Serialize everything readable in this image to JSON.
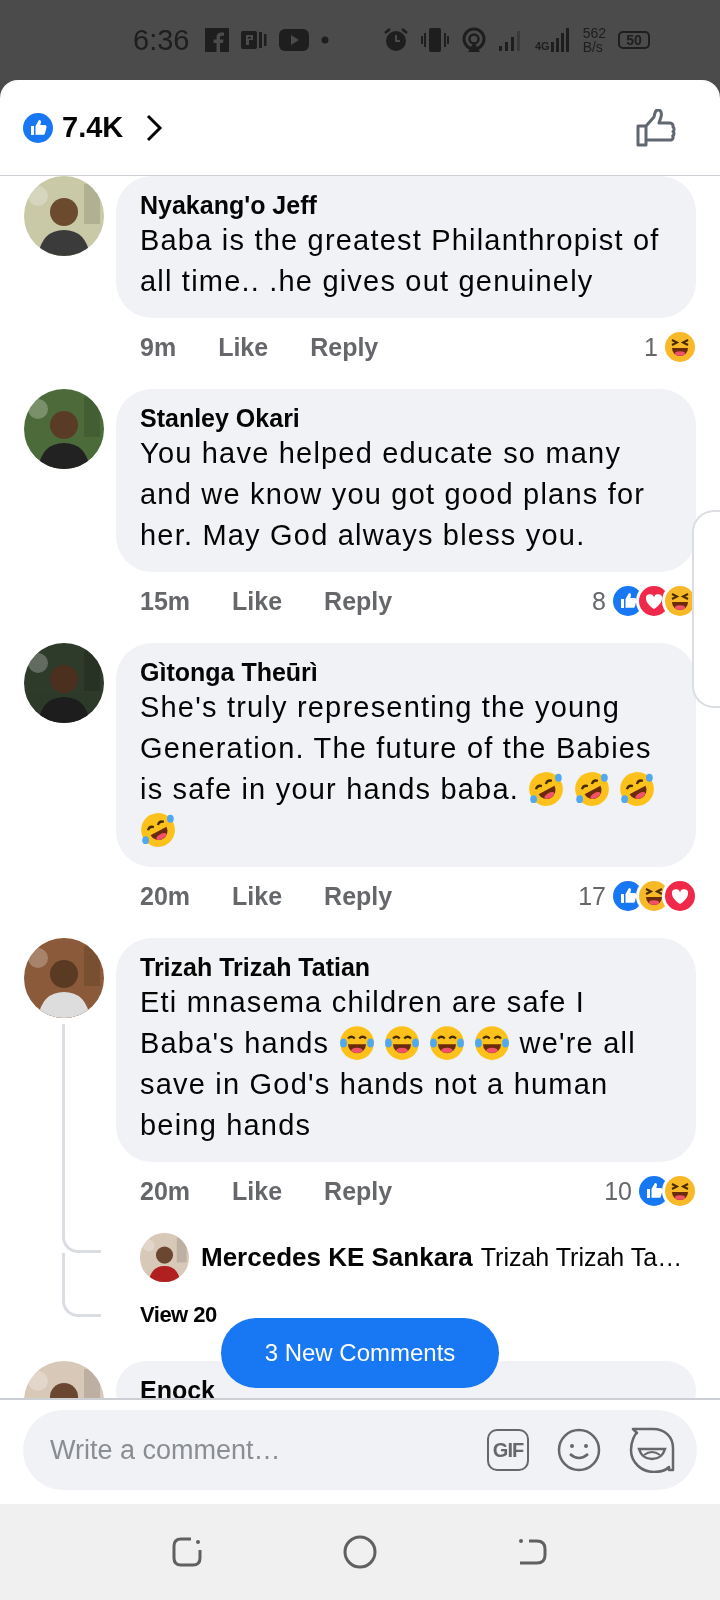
{
  "status_bar": {
    "time": "6:36",
    "network": "4G",
    "speed": "562",
    "speed_unit": "B/s",
    "battery": "50"
  },
  "header": {
    "reaction_count": "7.4K"
  },
  "comments": [
    {
      "author": "Nyakang'o Jeff",
      "body": [
        {
          "kind": "text",
          "text": "Baba is the greatest Philanthropist of all time.. .he gives out genuinely"
        }
      ],
      "time": "9m",
      "like": "Like",
      "reply": "Reply",
      "reaction_count": "1",
      "reactions": [
        {
          "kind": "haha"
        }
      ]
    },
    {
      "author": "Stanley Okari",
      "body": [
        {
          "kind": "text",
          "text": "You have helped educate so many and we know you got good plans for her. May God always bless you."
        }
      ],
      "time": "15m",
      "like": "Like",
      "reply": "Reply",
      "reaction_count": "8",
      "reactions": [
        {
          "kind": "like"
        },
        {
          "kind": "love"
        },
        {
          "kind": "haha"
        }
      ]
    },
    {
      "author": "Gìtonga Theūrì",
      "body": [
        {
          "kind": "text",
          "text": "She's truly representing the young Generation. The future of the Babies is safe in your hands baba."
        },
        {
          "kind": "rofl"
        },
        {
          "kind": "rofl"
        },
        {
          "kind": "rofl"
        },
        {
          "kind": "rofl"
        }
      ],
      "time": "20m",
      "like": "Like",
      "reply": "Reply",
      "reaction_count": "17",
      "reactions": [
        {
          "kind": "like"
        },
        {
          "kind": "haha"
        },
        {
          "kind": "love"
        }
      ]
    },
    {
      "author": "Trizah Trizah Tatian",
      "body": [
        {
          "kind": "text",
          "text": "Eti mnasema children are safe I Baba's hands"
        },
        {
          "kind": "joy"
        },
        {
          "kind": "joy"
        },
        {
          "kind": "joy"
        },
        {
          "kind": "joy"
        },
        {
          "kind": "text",
          "text": "we're all save in God's hands not a human being hands"
        }
      ],
      "time": "20m",
      "like": "Like",
      "reply": "Reply",
      "reaction_count": "10",
      "reactions": [
        {
          "kind": "like"
        },
        {
          "kind": "haha"
        }
      ],
      "replies": {
        "preview": {
          "author": "Mercedes KE Sankara",
          "text": "Trizah Trizah Ta…"
        },
        "more": "View 20"
      }
    },
    {
      "author": "Enock"
    }
  ],
  "new_comments_button": "3 New Comments",
  "composer": {
    "placeholder": "Write a comment…",
    "gif_label": "GIF"
  }
}
